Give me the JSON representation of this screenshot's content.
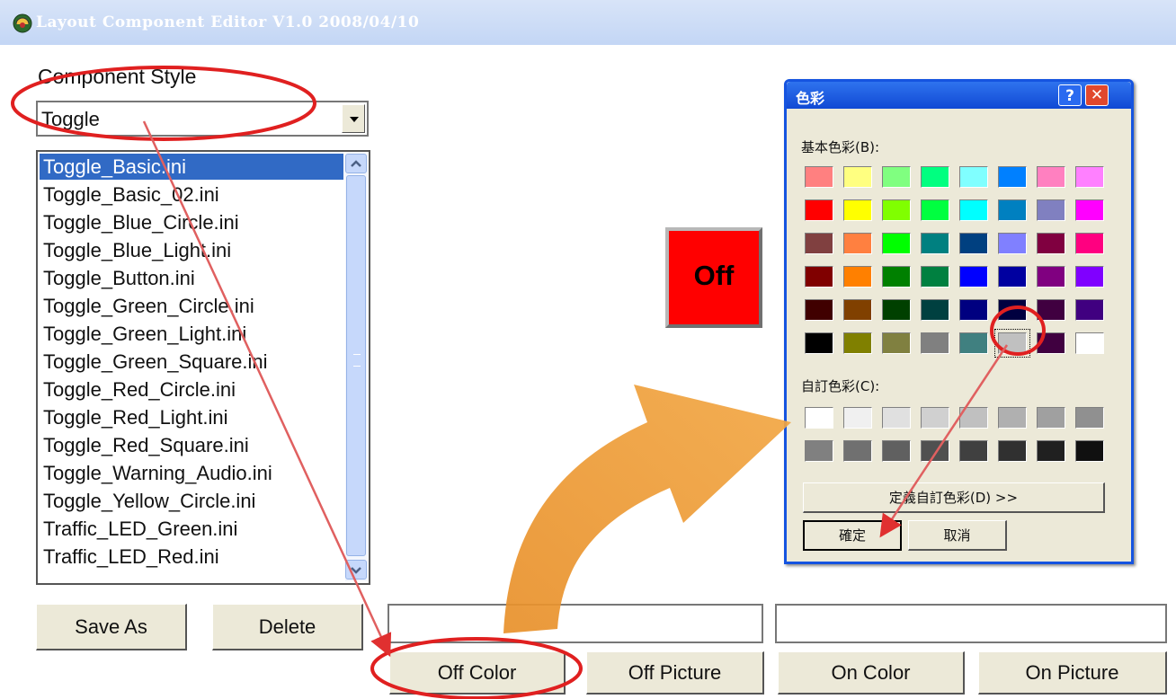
{
  "window": {
    "title": "Layout Component Editor V1.0  2008/04/10"
  },
  "style_label": "Component Style",
  "style_combo": {
    "value": "Toggle"
  },
  "list": {
    "items": [
      "Toggle_Basic.ini",
      "Toggle_Basic_02.ini",
      "Toggle_Blue_Circle.ini",
      "Toggle_Blue_Light.ini",
      "Toggle_Button.ini",
      "Toggle_Green_Circle.ini",
      "Toggle_Green_Light.ini",
      "Toggle_Green_Square.ini",
      "Toggle_Red_Circle.ini",
      "Toggle_Red_Light.ini",
      "Toggle_Red_Square.ini",
      "Toggle_Warning_Audio.ini",
      "Toggle_Yellow_Circle.ini",
      "Traffic_LED_Green.ini",
      "Traffic_LED_Red.ini"
    ],
    "selected_index": 0
  },
  "buttons": {
    "save_as": "Save As",
    "delete": "Delete",
    "off_color": "Off Color",
    "off_picture": "Off Picture",
    "on_color": "On Color",
    "on_picture": "On Picture"
  },
  "preview": {
    "label": "Off",
    "color": "#ff0000"
  },
  "color_dialog": {
    "title": "色彩",
    "help": "?",
    "close": "✕",
    "basic_label": "基本色彩(B):",
    "custom_label": "自訂色彩(C):",
    "define_button": "定義自訂色彩(D) >>",
    "ok_button": "確定",
    "cancel_button": "取消",
    "basic_colors": [
      [
        "#ff8080",
        "#ffff80",
        "#80ff80",
        "#00ff80",
        "#80ffff",
        "#0080ff",
        "#ff80c0",
        "#ff80ff"
      ],
      [
        "#ff0000",
        "#ffff00",
        "#80ff00",
        "#00ff40",
        "#00ffff",
        "#0080c0",
        "#8080c0",
        "#ff00ff"
      ],
      [
        "#804040",
        "#ff8040",
        "#00ff00",
        "#008080",
        "#004080",
        "#8080ff",
        "#800040",
        "#ff0080"
      ],
      [
        "#800000",
        "#ff8000",
        "#008000",
        "#008040",
        "#0000ff",
        "#0000a0",
        "#800080",
        "#8000ff"
      ],
      [
        "#400000",
        "#804000",
        "#004000",
        "#004040",
        "#000080",
        "#000040",
        "#400040",
        "#400080"
      ],
      [
        "#000000",
        "#808000",
        "#808040",
        "#808080",
        "#408080",
        "#c0c0c0",
        "#400040",
        "#ffffff"
      ]
    ],
    "selected_color": "#c0c0c0",
    "custom_colors": [
      [
        "#ffffff",
        "#f0f0f0",
        "#e0e0e0",
        "#d0d0d0",
        "#c0c0c0",
        "#b0b0b0",
        "#a0a0a0",
        "#909090"
      ],
      [
        "#808080",
        "#707070",
        "#606060",
        "#505050",
        "#404040",
        "#303030",
        "#202020",
        "#101010"
      ]
    ]
  }
}
